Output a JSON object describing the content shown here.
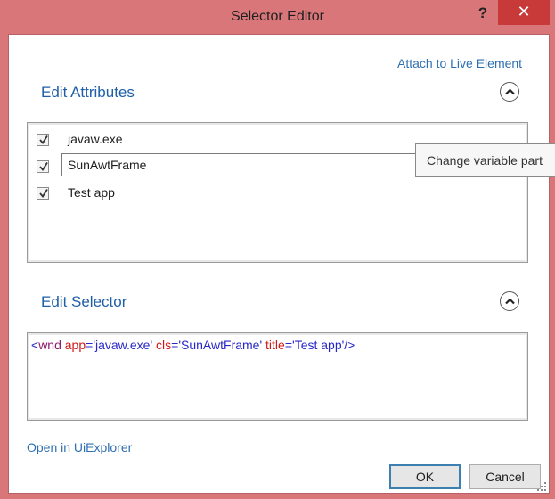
{
  "window": {
    "title": "Selector Editor",
    "help_glyph": "?",
    "close_glyph": "✕"
  },
  "attach_link": "Attach to Live Element",
  "edit_attributes": {
    "title": "Edit Attributes",
    "rows": [
      {
        "checked": true,
        "label": "javaw.exe",
        "editing": false
      },
      {
        "checked": true,
        "label": "SunAwtFrame",
        "editing": true
      },
      {
        "checked": true,
        "label": "Test app",
        "editing": false
      }
    ]
  },
  "tooltip": "Change variable part",
  "edit_selector": {
    "title": "Edit Selector",
    "selector_tokens": [
      {
        "text": "<",
        "kind": "punct"
      },
      {
        "text": "wnd",
        "kind": "tag"
      },
      {
        "text": " ",
        "kind": "punct"
      },
      {
        "text": "app",
        "kind": "attr"
      },
      {
        "text": "=",
        "kind": "punct"
      },
      {
        "text": "'javaw.exe'",
        "kind": "val"
      },
      {
        "text": " ",
        "kind": "punct"
      },
      {
        "text": "cls",
        "kind": "attr"
      },
      {
        "text": "=",
        "kind": "punct"
      },
      {
        "text": "'SunAwtFrame'",
        "kind": "val"
      },
      {
        "text": " ",
        "kind": "punct"
      },
      {
        "text": "title",
        "kind": "attr"
      },
      {
        "text": "=",
        "kind": "punct"
      },
      {
        "text": "'Test app'",
        "kind": "val"
      },
      {
        "text": "/>",
        "kind": "punct"
      }
    ]
  },
  "open_in_uiexplorer": "Open in UiExplorer",
  "buttons": {
    "ok": "OK",
    "cancel": "Cancel"
  },
  "colors": {
    "window_frame": "#d9767a",
    "close_button": "#c8393a",
    "link": "#2f6fb0",
    "section_title": "#1f5fa6"
  },
  "icons": {
    "collapse": "chevron-up-icon",
    "checkbox": "checkmark-icon",
    "resize": "resize-grip-icon"
  }
}
